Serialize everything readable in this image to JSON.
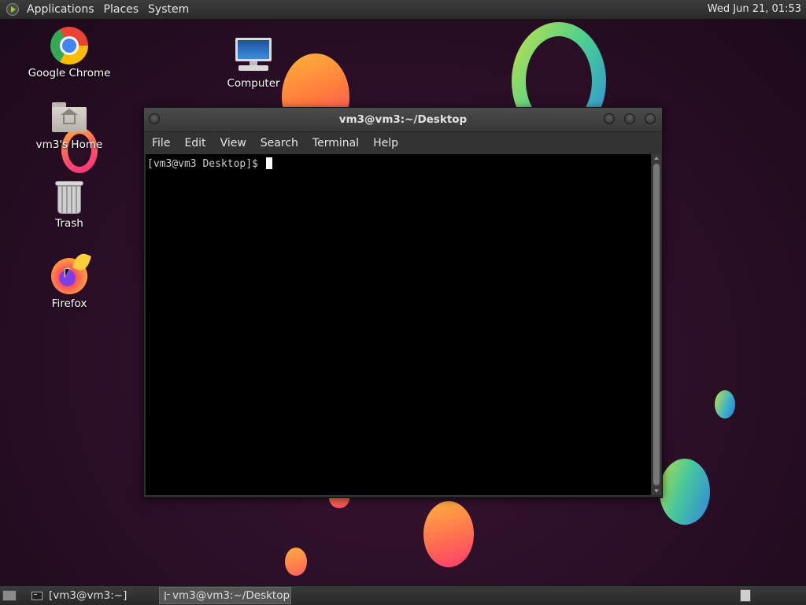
{
  "top_panel": {
    "menus": [
      "Applications",
      "Places",
      "System"
    ],
    "clock": "Wed Jun 21, 01:53"
  },
  "desktop": {
    "icons": [
      {
        "label": "Google Chrome",
        "icon": "chrome-icon"
      },
      {
        "label": "Computer",
        "icon": "computer-icon"
      },
      {
        "label": "vm3's Home",
        "icon": "home-folder-icon"
      },
      {
        "label": "Trash",
        "icon": "trash-icon"
      },
      {
        "label": "Firefox",
        "icon": "firefox-icon"
      }
    ]
  },
  "terminal": {
    "title": "vm3@vm3:~/Desktop",
    "menu": [
      "File",
      "Edit",
      "View",
      "Search",
      "Terminal",
      "Help"
    ],
    "prompt": "[vm3@vm3 Desktop]$ "
  },
  "taskbar": {
    "tasks": [
      {
        "label": "[vm3@vm3:~]",
        "active": false
      },
      {
        "label": "vm3@vm3:~/Desktop",
        "active": true
      }
    ]
  },
  "colors": {
    "accent_orange": "#ff7a3d",
    "accent_green": "#48c79a",
    "accent_blue": "#2e86e0",
    "wallpaper": "#2a0e26"
  }
}
